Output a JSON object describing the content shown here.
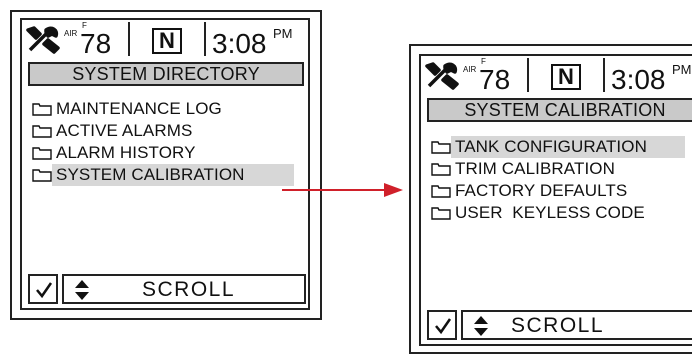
{
  "screens": [
    {
      "air_label": "AIR",
      "unit_label": "F",
      "temperature": "78",
      "gear_indicator": "N",
      "time": "3:08",
      "time_suffix": "PM",
      "title": "SYSTEM DIRECTORY",
      "items": [
        {
          "label": "MAINTENANCE LOG"
        },
        {
          "label": "ACTIVE ALARMS"
        },
        {
          "label": "ALARM HISTORY"
        },
        {
          "label": "SYSTEM CALIBRATION",
          "selected": true
        }
      ],
      "scroll_label": "SCROLL"
    },
    {
      "air_label": "AIR",
      "unit_label": "F",
      "temperature": "78",
      "gear_indicator": "N",
      "time": "3:08",
      "time_suffix": "PM",
      "title": "SYSTEM CALIBRATION",
      "items": [
        {
          "label": "TANK CONFIGURATION",
          "selected": true
        },
        {
          "label": "TRIM CALIBRATION"
        },
        {
          "label": "FACTORY DEFAULTS"
        },
        {
          "label": "USER  KEYLESS CODE"
        }
      ],
      "scroll_label": "SCROLL"
    }
  ],
  "colors": {
    "title_bar": "#c9c9c9",
    "selection": "#d7d7d7",
    "arrow": "#d0202a"
  },
  "icons": {
    "tools": "wrench-screwdriver-icon",
    "folder": "folder-icon",
    "checkmark": "checkmark-icon",
    "updown": "up-down-arrows-icon"
  }
}
